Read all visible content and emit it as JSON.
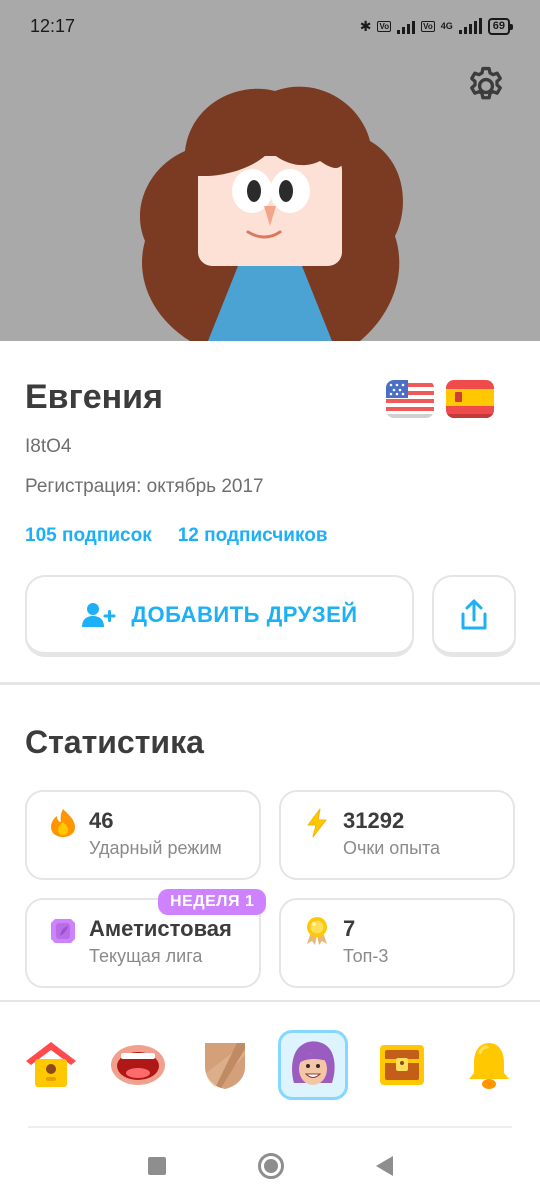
{
  "status_bar": {
    "time": "12:17",
    "volte_label": "Vo LTE",
    "network": "4G",
    "battery": "69"
  },
  "profile": {
    "name": "Евгения",
    "username": "I8tO4",
    "joined": "Регистрация: октябрь 2017",
    "following": "105 подписок",
    "followers": "12 подписчиков",
    "add_friends_label": "ДОБАВИТЬ ДРУЗЕЙ",
    "flags": [
      "us-flag",
      "es-flag"
    ]
  },
  "stats": {
    "title": "Статистика",
    "cards": [
      {
        "value": "46",
        "label": "Ударный режим",
        "icon": "flame-icon"
      },
      {
        "value": "31292",
        "label": "Очки опыта",
        "icon": "lightning-icon"
      },
      {
        "value": "Аметистовая",
        "label": "Текущая лига",
        "icon": "amethyst-league-icon",
        "badge": "НЕДЕЛЯ 1"
      },
      {
        "value": "7",
        "label": "Топ-3",
        "icon": "medal-icon"
      }
    ]
  },
  "bottom_nav": {
    "items": [
      "home-icon",
      "speak-mouth-icon",
      "shield-icon",
      "profile-icon",
      "chest-icon",
      "bell-icon"
    ],
    "active": "profile-icon"
  },
  "colors": {
    "accent": "#1cb0f6",
    "header_bg": "#a9a9a9",
    "league_badge": "#ce82ff",
    "border": "#e5e5e5"
  }
}
